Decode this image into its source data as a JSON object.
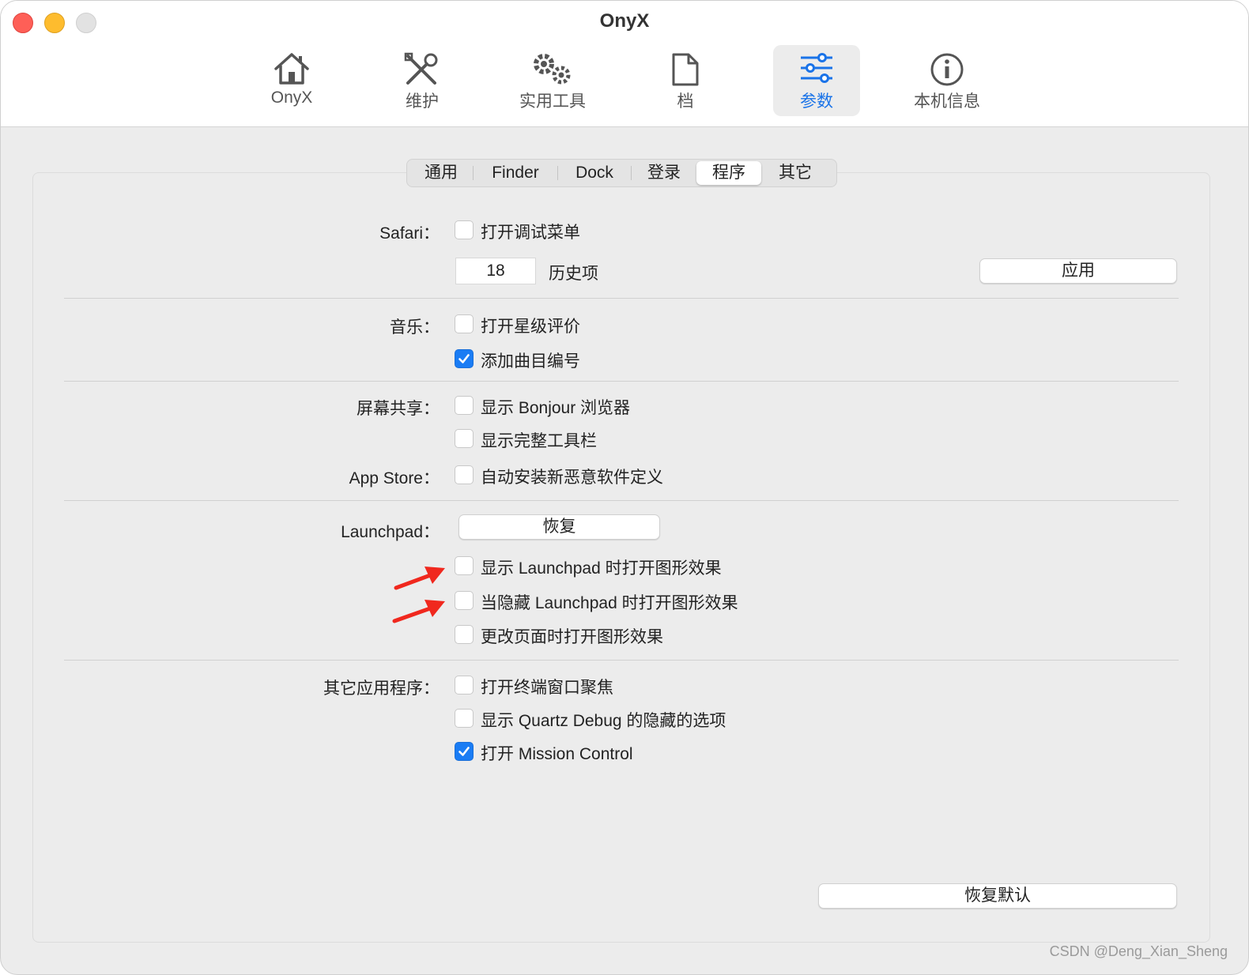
{
  "window": {
    "title": "OnyX"
  },
  "toolbar": {
    "items": [
      {
        "label": "OnyX",
        "icon": "house-icon"
      },
      {
        "label": "维护",
        "icon": "tools-icon"
      },
      {
        "label": "实用工具",
        "icon": "gears-icon"
      },
      {
        "label": "档",
        "icon": "document-icon"
      },
      {
        "label": "参数",
        "icon": "sliders-icon",
        "active": true
      },
      {
        "label": "本机信息",
        "icon": "info-icon"
      }
    ]
  },
  "tabs": [
    "通用",
    "Finder",
    "Dock",
    "登录",
    "程序",
    "其它"
  ],
  "active_tab": "程序",
  "sections": {
    "safari": {
      "label": "Safari：",
      "debug_menu": {
        "label": "打开调试菜单",
        "checked": false
      },
      "history_value": "18",
      "history_label": "历史项",
      "apply_button": "应用"
    },
    "music": {
      "label": "音乐：",
      "star_rating": {
        "label": "打开星级评价",
        "checked": false
      },
      "track_numbers": {
        "label": "添加曲目编号",
        "checked": true
      }
    },
    "screen_sharing": {
      "label": "屏幕共享：",
      "bonjour": {
        "label": "显示 Bonjour 浏览器",
        "checked": false
      },
      "full_toolbar": {
        "label": "显示完整工具栏",
        "checked": false
      }
    },
    "app_store": {
      "label": "App Store：",
      "auto_malware": {
        "label": "自动安装新恶意软件定义",
        "checked": false
      }
    },
    "launchpad": {
      "label": "Launchpad：",
      "reset_button": "恢复",
      "show_effect": {
        "label": "显示 Launchpad 时打开图形效果",
        "checked": false
      },
      "hide_effect": {
        "label": "当隐藏 Launchpad 时打开图形效果",
        "checked": false
      },
      "page_effect": {
        "label": "更改页面时打开图形效果",
        "checked": false
      }
    },
    "other_apps": {
      "label": "其它应用程序：",
      "terminal_focus": {
        "label": "打开终端窗口聚焦",
        "checked": false
      },
      "quartz_debug": {
        "label": "显示 Quartz Debug 的隐藏的选项",
        "checked": false
      },
      "mission_control": {
        "label": "打开 Mission Control",
        "checked": true
      }
    }
  },
  "restore_defaults_button": "恢复默认",
  "watermark": "CSDN @Deng_Xian_Sheng",
  "colors": {
    "accent": "#1a7cf4",
    "annotation_arrow": "#f0281e"
  }
}
